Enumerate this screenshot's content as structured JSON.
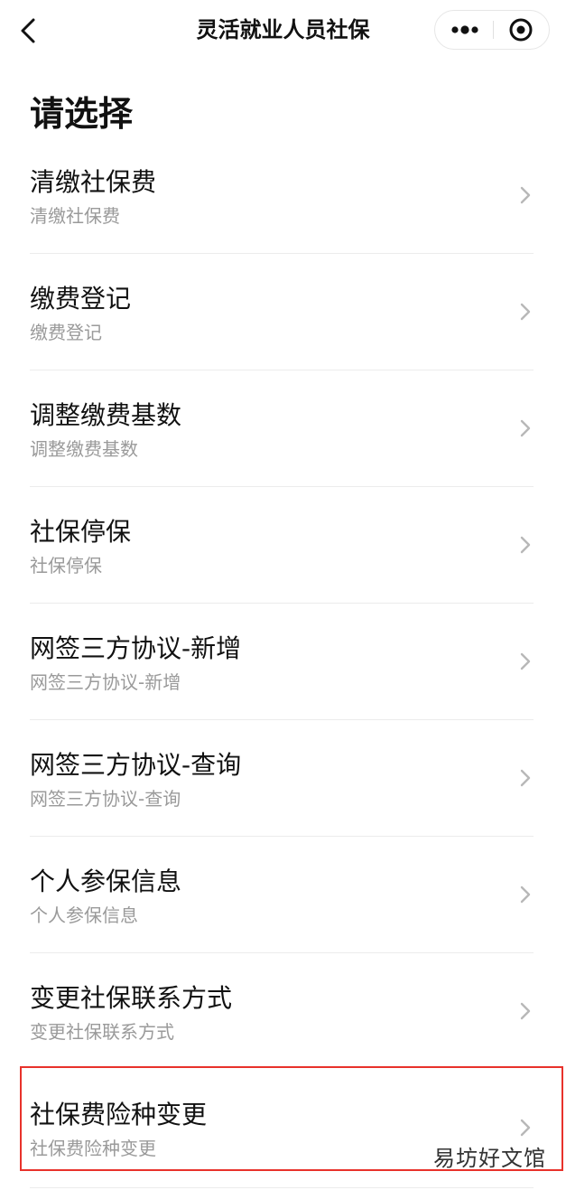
{
  "nav": {
    "title": "灵活就业人员社保",
    "back_icon": "chevron-left-icon",
    "more_icon": "more-dots-icon",
    "close_icon": "target-close-icon"
  },
  "page": {
    "heading": "请选择"
  },
  "items": [
    {
      "label": "清缴社保费",
      "sub": "清缴社保费"
    },
    {
      "label": "缴费登记",
      "sub": "缴费登记"
    },
    {
      "label": "调整缴费基数",
      "sub": "调整缴费基数"
    },
    {
      "label": "社保停保",
      "sub": "社保停保"
    },
    {
      "label": "网签三方协议-新增",
      "sub": "网签三方协议-新增"
    },
    {
      "label": "网签三方协议-查询",
      "sub": "网签三方协议-查询"
    },
    {
      "label": "个人参保信息",
      "sub": "个人参保信息"
    },
    {
      "label": "变更社保联系方式",
      "sub": "变更社保联系方式"
    },
    {
      "label": "社保费险种变更",
      "sub": "社保费险种变更"
    }
  ],
  "highlight": {
    "color": "#e8322b"
  },
  "watermark": {
    "text": "易坊好文馆"
  },
  "colors": {
    "text_primary": "#111111",
    "text_secondary": "#9a9a9a",
    "divider": "#ececec",
    "chevron": "#b8b8b8"
  }
}
